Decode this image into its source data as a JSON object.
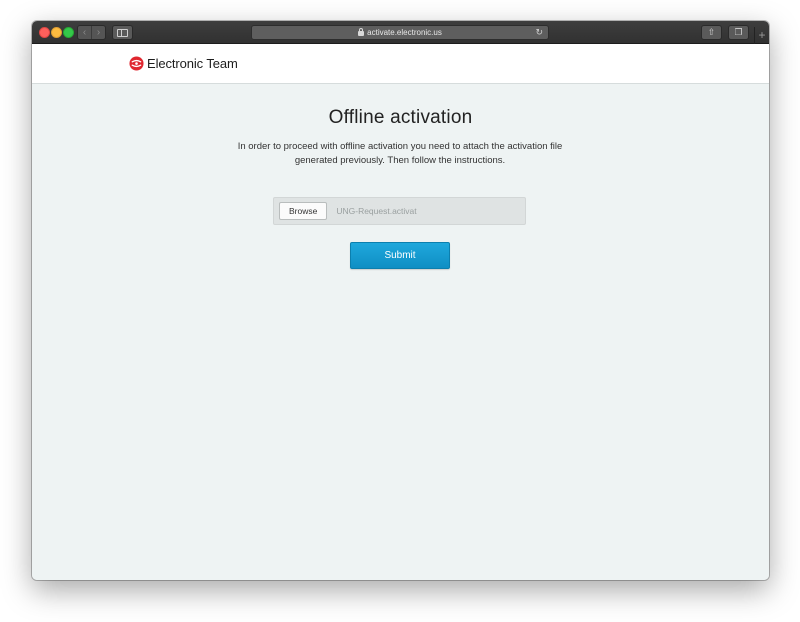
{
  "browser": {
    "url": "activate.electronic.us",
    "back_glyph": "‹",
    "forward_glyph": "›",
    "reload_glyph": "↻",
    "share_glyph": "⇧",
    "tabs_glyph": "❐",
    "newtab_glyph": "+"
  },
  "header": {
    "logo_text": "Electronic Team",
    "logo_color": "#e0262f"
  },
  "main": {
    "title": "Offline activation",
    "description": "In order to proceed with offline activation you need to attach the activation file generated previously. Then follow the instructions.",
    "file_input": {
      "browse_label": "Browse",
      "file_name": "UNG-Request.activat"
    },
    "submit_label": "Submit",
    "accent_color": "#1a9fd6"
  }
}
